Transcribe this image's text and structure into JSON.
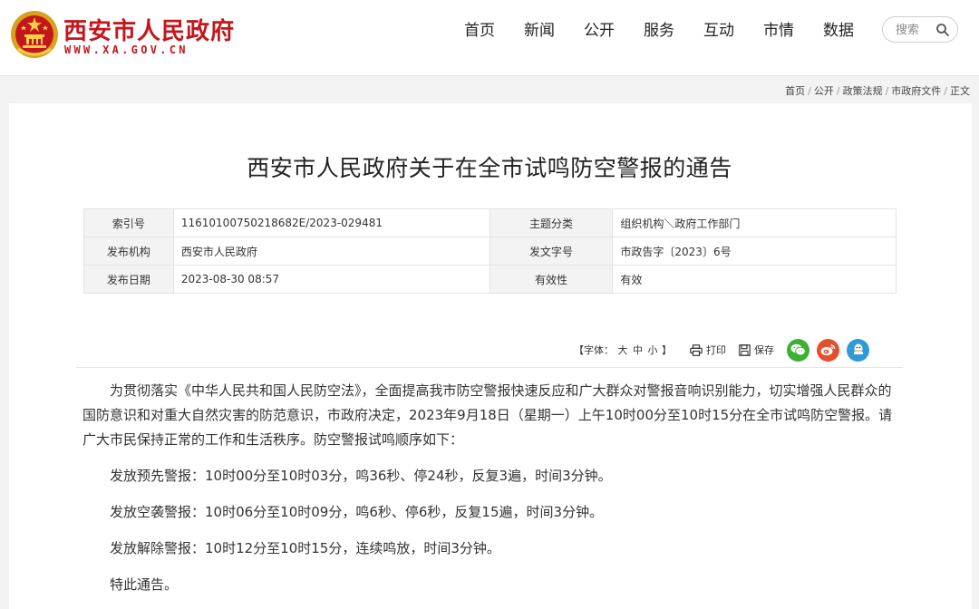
{
  "header": {
    "site_name": "西安市人民政府",
    "site_url": "WWW.XA.GOV.CN",
    "nav": [
      "首页",
      "新闻",
      "公开",
      "服务",
      "互动",
      "市情",
      "数据"
    ],
    "search_placeholder": "搜索"
  },
  "breadcrumb": {
    "items": [
      "首页",
      "公开",
      "政策法规",
      "市政府文件",
      "正文"
    ],
    "sep": "/"
  },
  "article": {
    "title": "西安市人民政府关于在全市试鸣防空警报的通告",
    "meta": {
      "index_label": "索引号",
      "index_value": "11610100750218682E/2023-029481",
      "topic_label": "主题分类",
      "topic_value": "组织机构＼政府工作部门",
      "issuer_label": "发布机构",
      "issuer_value": "西安市人民政府",
      "docno_label": "发文字号",
      "docno_value": "市政告字〔2023〕6号",
      "date_label": "发布日期",
      "date_value": "2023-08-30 08:57",
      "validity_label": "有效性",
      "validity_value": "有效"
    },
    "tools": {
      "font_prefix": "【字体：",
      "font_large": "大",
      "font_medium": "中",
      "font_small": "小",
      "font_suffix": "】",
      "print": "打印",
      "save": "保存"
    },
    "paragraphs": {
      "intro": "为贯彻落实《中华人民共和国人民防空法》，全面提高我市防空警报快速反应和广大群众对警报音响识别能力，切实增强人民群众的国防意识和对重大自然灾害的防范意识，市政府决定，2023年9月18日（星期一）上午10时00分至10时15分在全市试鸣防空警报。请广大市民保持正常的工作和生活秩序。防空警报试鸣顺序如下：",
      "alert1": "发放预先警报：10时00分至10时03分，鸣36秒、停24秒，反复3遍，时间3分钟。",
      "alert2": "发放空袭警报：10时06分至10时09分，鸣6秒、停6秒，反复15遍，时间3分钟。",
      "alert3": "发放解除警报：10时12分至10时15分，连续鸣放，时间3分钟。",
      "closing": "特此通告。"
    }
  },
  "colors": {
    "brand_red": "#c4161c",
    "wechat": "#3cb034",
    "weibo": "#e5502c",
    "qq": "#2e9ad8"
  },
  "icons": [
    "national-emblem-icon",
    "search-icon",
    "print-icon",
    "save-icon",
    "wechat-icon",
    "weibo-icon",
    "qq-icon"
  ]
}
